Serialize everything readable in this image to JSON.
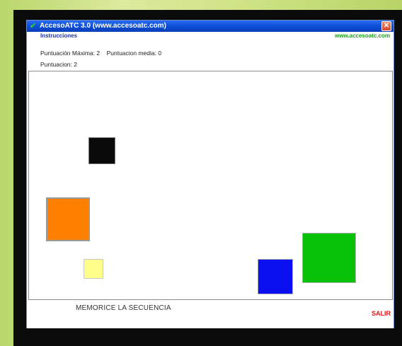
{
  "window": {
    "title": "AccesoATC 3.0 (www.accesoatc.com)",
    "icon": "leaf-icon",
    "close_symbol": "✕"
  },
  "menu": {
    "instrucciones": "Instrucciones",
    "site_link": "www.accesoatc.com"
  },
  "stats": {
    "max_label": "Puntuación Máxima:",
    "max_value": "2",
    "mean_label": "Puntuacion media:",
    "mean_value": "0",
    "score_label": "Puntuacion:",
    "score_value": "2"
  },
  "squares": [
    {
      "name": "black-square",
      "color": "#0a0a0a"
    },
    {
      "name": "orange-square",
      "color": "#ff7f00"
    },
    {
      "name": "yellow-square",
      "color": "#ffff8a"
    },
    {
      "name": "blue-square",
      "color": "#0a10f0"
    },
    {
      "name": "green-square",
      "color": "#08c208"
    }
  ],
  "footer": {
    "instruction": "MEMORICE LA SECUENCIA",
    "exit_label": "SALIR"
  }
}
